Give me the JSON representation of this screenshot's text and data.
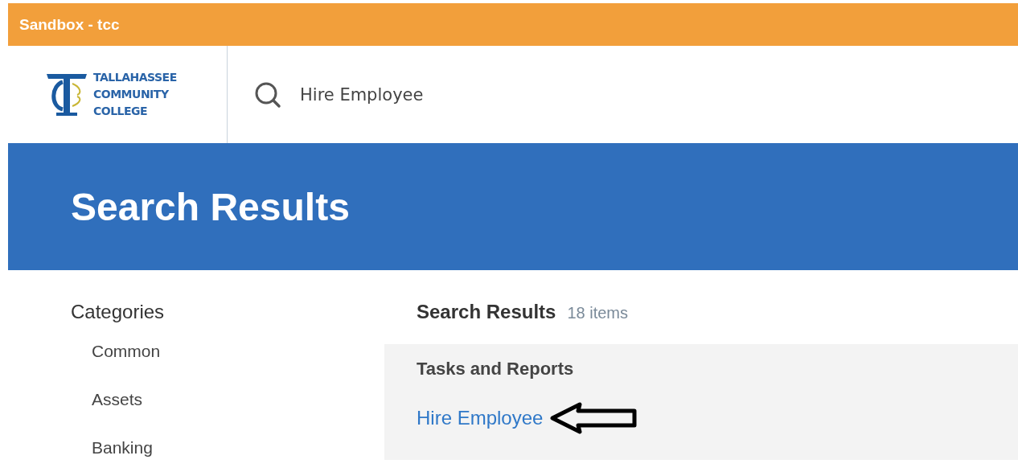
{
  "environment_bar": {
    "title": "Sandbox - tcc"
  },
  "header": {
    "logo_lines": [
      "TALLAHASSEE",
      "COMMUNITY",
      "COLLEGE"
    ],
    "search": {
      "value": "Hire Employee"
    }
  },
  "banner": {
    "title": "Search Results"
  },
  "categories": {
    "heading": "Categories",
    "items": [
      {
        "label": "Common"
      },
      {
        "label": "Assets"
      },
      {
        "label": "Banking"
      }
    ]
  },
  "results": {
    "heading": "Search Results",
    "count": "18 items",
    "group": {
      "heading": "Tasks and Reports",
      "items": [
        {
          "label": "Hire Employee",
          "pointed": true
        }
      ]
    }
  }
}
